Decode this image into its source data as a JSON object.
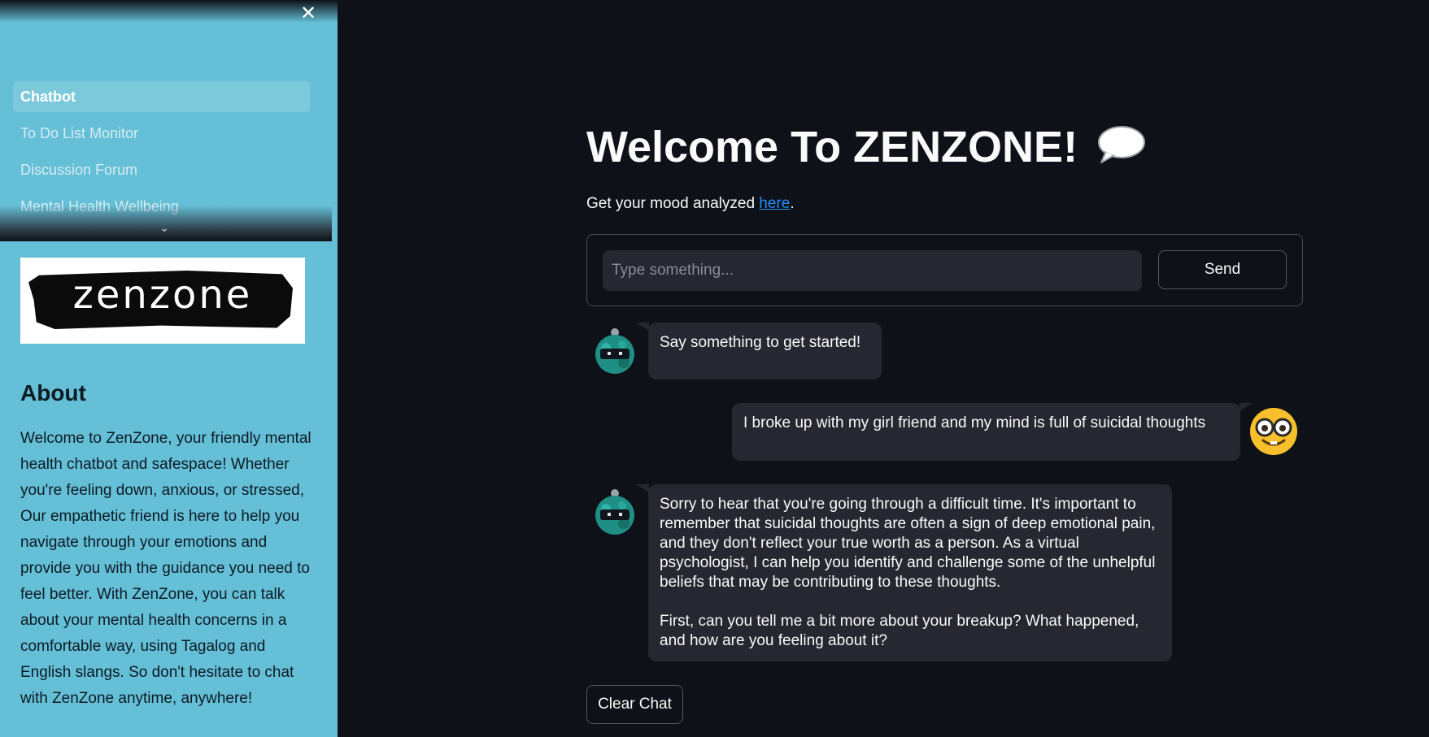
{
  "sidebar": {
    "nav_items": [
      {
        "label": "Chatbot",
        "active": true
      },
      {
        "label": "To Do List Monitor"
      },
      {
        "label": "Discussion Forum"
      },
      {
        "label": "Mental Health Wellbeing"
      }
    ],
    "logo_text": "zenzone",
    "about_title": "About",
    "about_text": "Welcome to ZenZone, your friendly mental health chatbot and safespace! Whether you're feeling down, anxious, or stressed, Our empathetic friend is here to help you navigate through your emotions and provide you with the guidance you need to feel better. With ZenZone, you can talk about your mental health concerns in a comfortable way, using Tagalog and English slangs. So don't hesitate to chat with ZenZone anytime, anywhere!",
    "background_color": "#65bfd6"
  },
  "main": {
    "title": "Welcome To ZENZONE!",
    "title_icon": "speech-bubble-icon",
    "mood_prefix": "Get your mood analyzed ",
    "mood_link": "here",
    "mood_suffix": ".",
    "input_placeholder": "Type something...",
    "send_label": "Send",
    "clear_label": "Clear Chat"
  },
  "messages": [
    {
      "role": "bot",
      "avatar": "robot-avatar-icon",
      "text": [
        "Say something to get started!"
      ]
    },
    {
      "role": "user",
      "avatar": "nerd-face-avatar-icon",
      "text": [
        "I broke up with my girl friend and my mind is full of suicidal thoughts"
      ]
    },
    {
      "role": "bot",
      "avatar": "robot-avatar-icon",
      "text": [
        "Sorry to hear that you're going through a difficult time. It's important to remember that suicidal thoughts are often a sign of deep emotional pain, and they don't reflect your true worth as a person. As a virtual psychologist, I can help you identify and challenge some of the unhelpful beliefs that may be contributing to these thoughts.",
        "First, can you tell me a bit more about your breakup? What happened, and how are you feeling about it?"
      ]
    }
  ],
  "colors": {
    "background": "#0e1117",
    "bubble": "#262730",
    "link": "#1e90ff"
  }
}
